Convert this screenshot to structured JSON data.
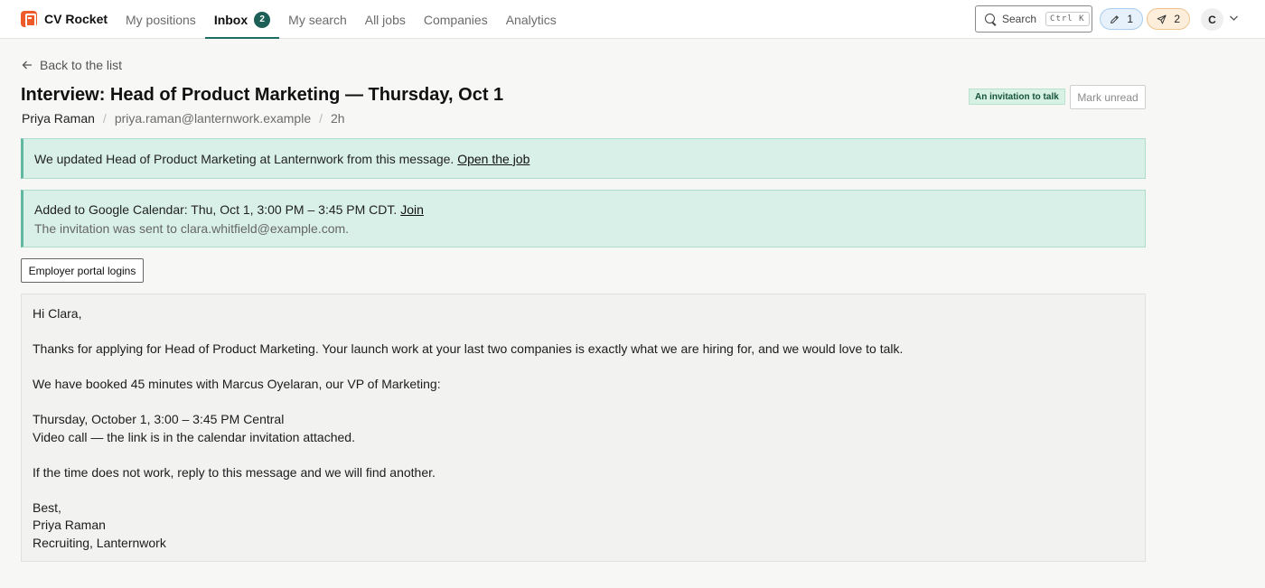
{
  "brand": {
    "name": "CV Rocket"
  },
  "nav": {
    "items": [
      {
        "label": "My positions"
      },
      {
        "label": "Inbox",
        "badge": "2",
        "active": true
      },
      {
        "label": "My search"
      },
      {
        "label": "All jobs"
      },
      {
        "label": "Companies"
      },
      {
        "label": "Analytics"
      }
    ]
  },
  "search": {
    "label": "Search",
    "shortcut": "Ctrl K"
  },
  "pills": {
    "drafts_count": "1",
    "sent_count": "2"
  },
  "user": {
    "initial": "C"
  },
  "back": {
    "label": "Back to the list"
  },
  "message_header": {
    "title": "Interview: Head of Product Marketing — Thursday, Oct 1",
    "sender_name": "Priya Raman",
    "sender_email": "priya.raman@lanternwork.example",
    "age": "2h",
    "tag": "An invitation to talk",
    "mark_unread": "Mark unread"
  },
  "notices": {
    "job_update": "We updated Head of Product Marketing at Lanternwork from this message.",
    "job_link": "Open the job",
    "calendar": "Added to Google Calendar: Thu, Oct 1, 3:00 PM – 3:45 PM CDT.",
    "calendar_link": "Join",
    "calendar_sub": "The invitation was sent to clara.whitfield@example.com."
  },
  "portal_button": "Employer portal logins",
  "body": {
    "greeting": "Hi Clara,",
    "p1": "Thanks for applying for Head of Product Marketing. Your launch work at your last two companies is exactly what we are hiring for, and we would love to talk.",
    "p2": "We have booked 45 minutes with Marcus Oyelaran, our VP of Marketing:",
    "when": "Thursday, October 1, 3:00 – 3:45 PM Central",
    "where": "Video call — the link is in the calendar invitation attached.",
    "p3": "If the time does not work, reply to this message and we will find another.",
    "signoff": "Best,",
    "sig_name": "Priya Raman",
    "sig_role": "Recruiting, Lanternwork"
  },
  "colors": {
    "accent": "#1c6e63",
    "brand": "#ef5a2a",
    "notice_bg": "#d8f0e8",
    "tag_bg": "#d7f1e5"
  }
}
